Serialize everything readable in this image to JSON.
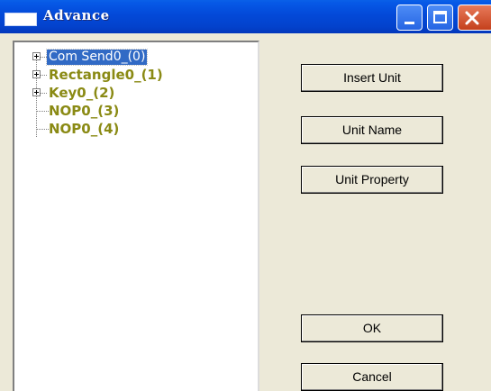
{
  "window": {
    "title": "Advance",
    "controls": {
      "minimize": "minimize-icon",
      "maximize": "maximize-icon",
      "close": "close-icon"
    }
  },
  "tree": {
    "items": [
      {
        "label": "Com Send0_(0)",
        "expandable": true,
        "selected": true
      },
      {
        "label": "Rectangle0_(1)",
        "expandable": true,
        "selected": false
      },
      {
        "label": "Key0_(2)",
        "expandable": true,
        "selected": false
      },
      {
        "label": "NOP0_(3)",
        "expandable": false,
        "selected": false
      },
      {
        "label": "NOP0_(4)",
        "expandable": false,
        "selected": false
      }
    ]
  },
  "buttons": {
    "insert_unit": "Insert Unit",
    "unit_name": "Unit Name",
    "unit_property": "Unit Property",
    "ok": "OK",
    "cancel": "Cancel"
  },
  "colors": {
    "titlebar": "#0349d8",
    "selection": "#316ac5",
    "unit_label": "#8a8a14",
    "dialog_bg": "#ece9d8"
  }
}
